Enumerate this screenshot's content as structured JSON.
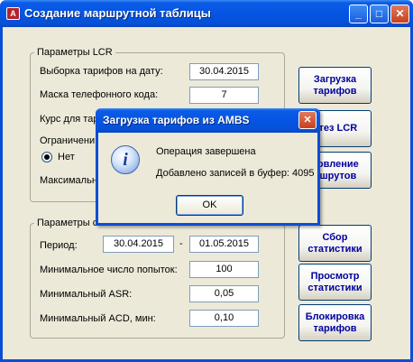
{
  "window": {
    "icon": "access-form-icon",
    "title": "Создание маршрутной таблицы",
    "buttons": {
      "minimize": "_",
      "maximize": "□",
      "close": "✕"
    }
  },
  "lcr_group": {
    "title": "Параметры  LCR",
    "rows": [
      {
        "label": "Выборка тарифов на дату:",
        "value": "30.04.2015"
      },
      {
        "label": "Маска телефонного кода:",
        "value": "7"
      },
      {
        "label": "Курс для тар",
        "value": ""
      }
    ],
    "restriction_label": "Ограничени",
    "radio_label": "Нет",
    "max_label": "Максимальн"
  },
  "stats_group": {
    "title": "Параметры с",
    "period_label": "Период:",
    "period_from": "30.04.2015",
    "period_sep": "-",
    "period_to": "01.05.2015",
    "rows": [
      {
        "label": "Минимальное число попыток:",
        "value": "100"
      },
      {
        "label": "Минимальный ASR:",
        "value": "0,05"
      },
      {
        "label": "Минимальный ACD, мин:",
        "value": "0,10"
      }
    ]
  },
  "side_buttons": [
    "Загрузка\nтарифов",
    "нтез LCR",
    "новление\nршрутов",
    "Сбор\nстатистики",
    "Просмотр\nстатистики",
    "Блокировка\nтарифов"
  ],
  "dialog": {
    "title": "Загрузка тарифов из AMBS",
    "icon": "info-icon",
    "line1": "Операция завершена",
    "line2": "Добавлено записей в буфер: 4095",
    "ok": "OK",
    "close": "✕"
  }
}
